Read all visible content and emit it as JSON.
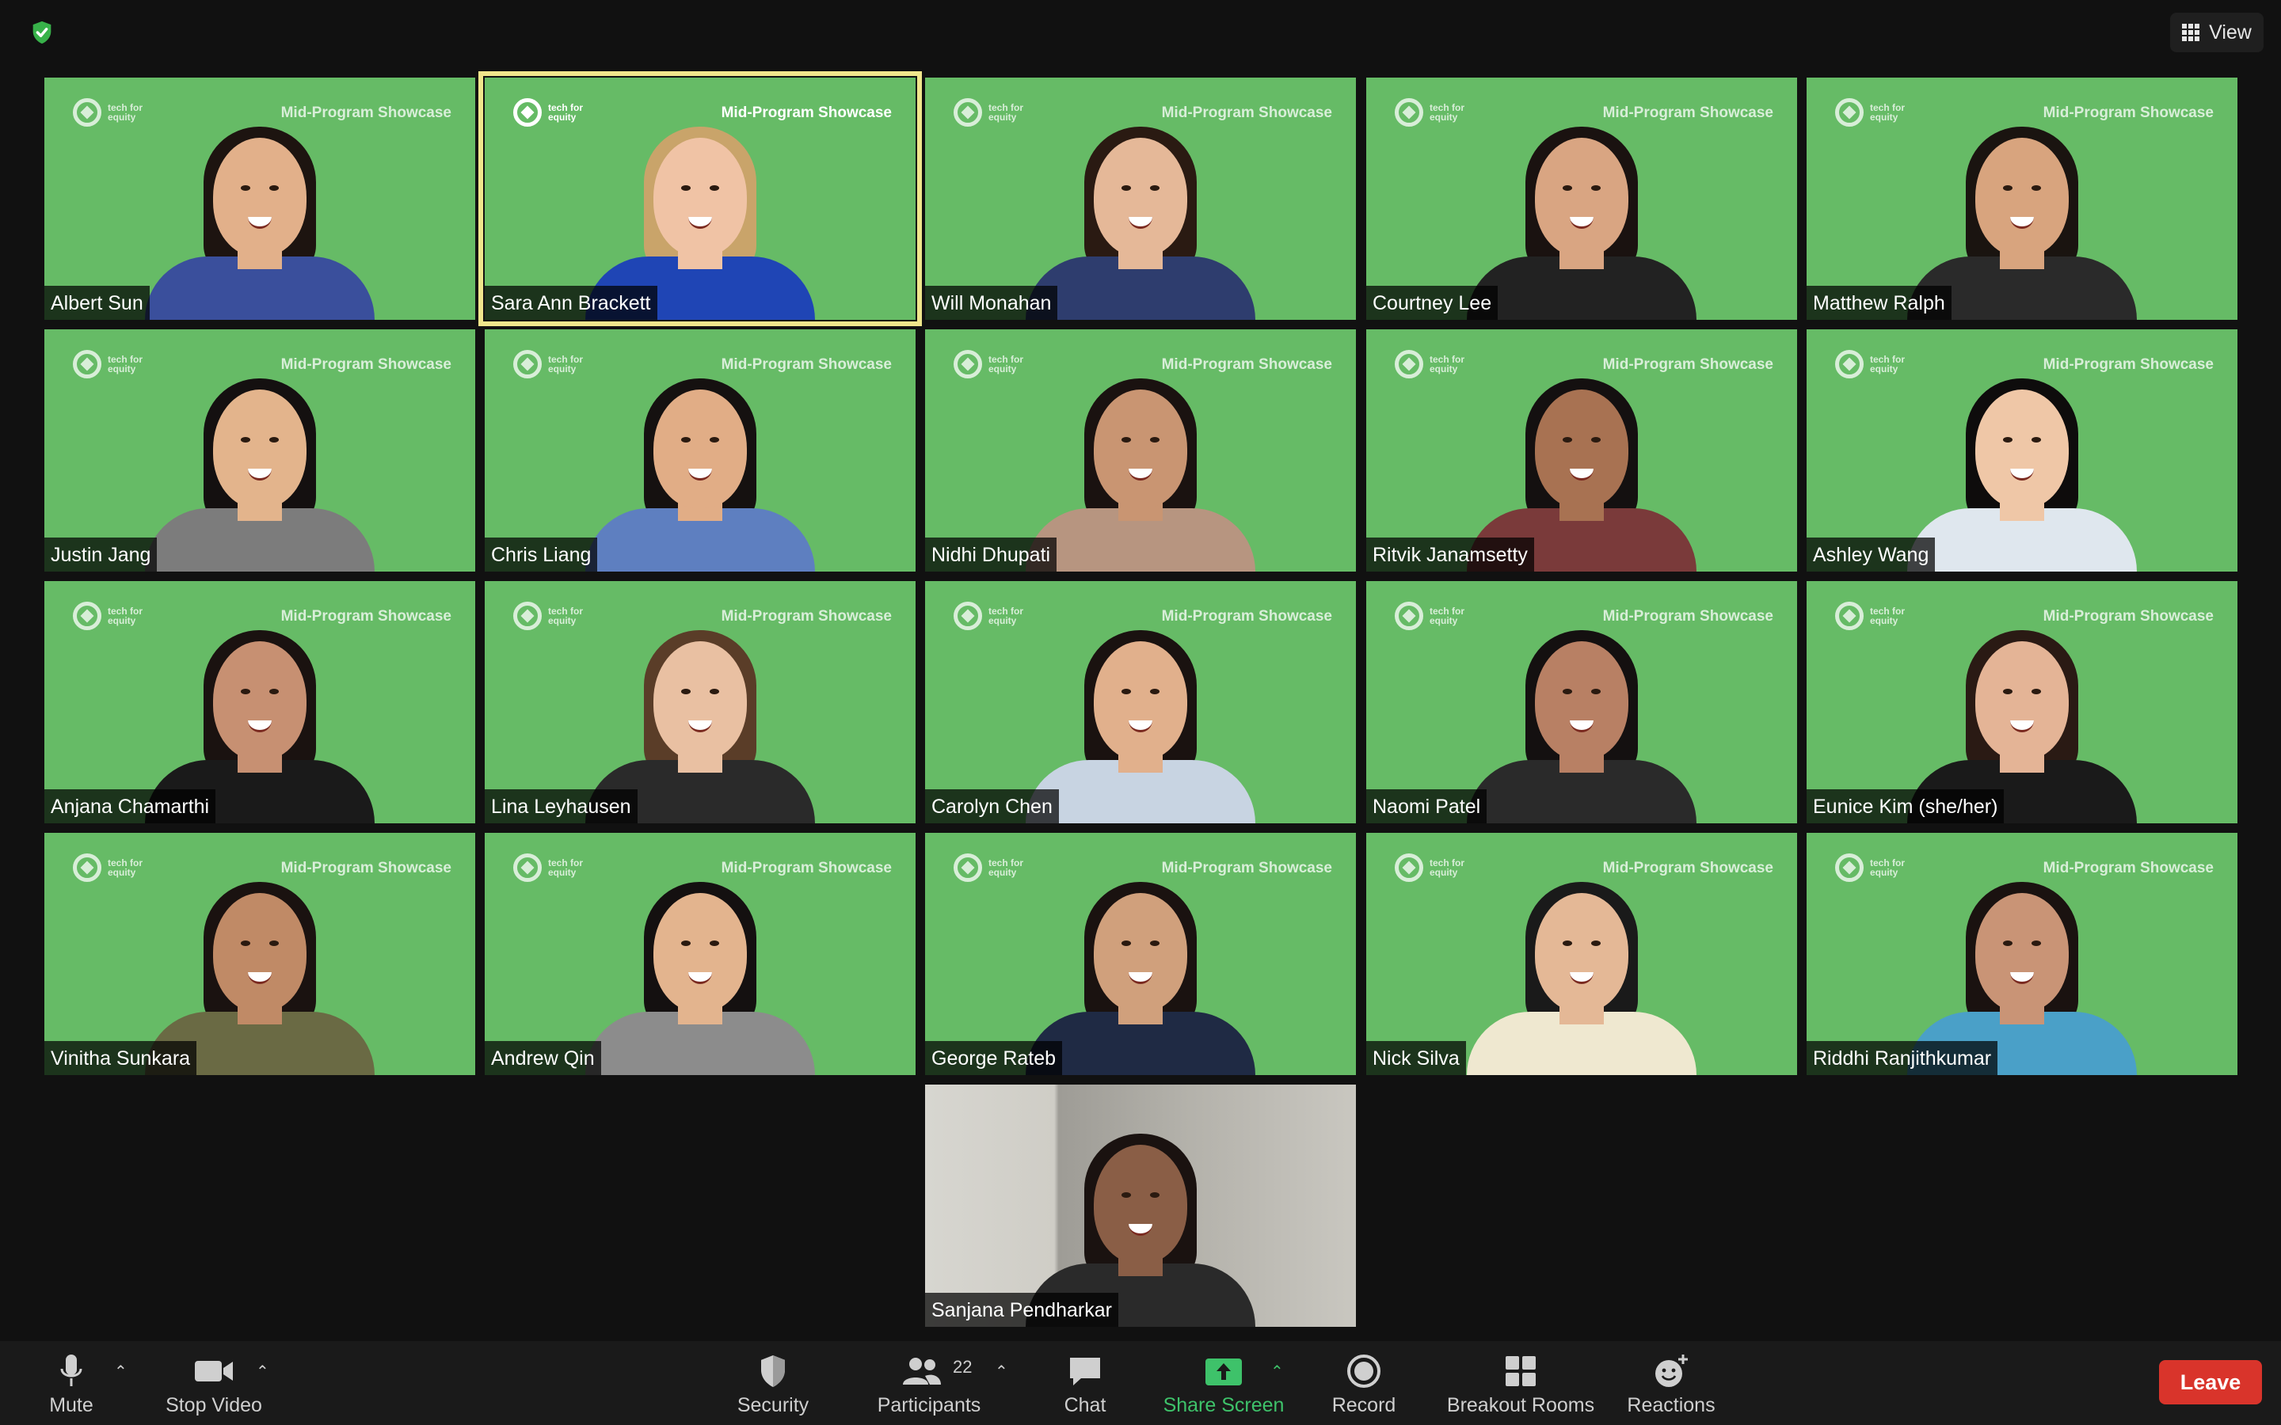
{
  "window": {
    "view_label": "View"
  },
  "meeting": {
    "brand_text": "tech for equity",
    "showcase_label": "Mid-Program Showcase"
  },
  "participants": [
    {
      "name": "Albert Sun",
      "skin": "#e2b08a",
      "hair": "#1d1410",
      "shirt": "#3a4f9c"
    },
    {
      "name": "Sara Ann Brackett",
      "skin": "#f0c3a5",
      "hair": "#c9a46a",
      "shirt": "#1f45b5"
    },
    {
      "name": "Will Monahan",
      "skin": "#e5b898",
      "hair": "#2a1a12",
      "shirt": "#2e3d6e"
    },
    {
      "name": "Courtney Lee",
      "skin": "#d9a582",
      "hair": "#1a1210",
      "shirt": "#222222"
    },
    {
      "name": "Matthew Ralph",
      "skin": "#d8a47e",
      "hair": "#1a1410",
      "shirt": "#2a2a2a"
    },
    {
      "name": "Justin Jang",
      "skin": "#e3b48c",
      "hair": "#141010",
      "shirt": "#7c7c7c"
    },
    {
      "name": "Chris Liang",
      "skin": "#e1ad86",
      "hair": "#151110",
      "shirt": "#5e7fc0"
    },
    {
      "name": "Nidhi Dhupati",
      "skin": "#c99572",
      "hair": "#1a1210",
      "shirt": "#b79580"
    },
    {
      "name": "Ritvik Janamsetty",
      "skin": "#a87252",
      "hair": "#141010",
      "shirt": "#7a3a3a"
    },
    {
      "name": "Ashley Wang",
      "skin": "#efc7a7",
      "hair": "#0e0c0c",
      "shirt": "#dfe7ee"
    },
    {
      "name": "Anjana Chamarthi",
      "skin": "#c79072",
      "hair": "#1a1210",
      "shirt": "#1a1a1a"
    },
    {
      "name": "Lina Leyhausen",
      "skin": "#e9c0a2",
      "hair": "#5a3d28",
      "shirt": "#2a2a2a"
    },
    {
      "name": "Carolyn Chen",
      "skin": "#e1b08c",
      "hair": "#1a1210",
      "shirt": "#c8d4e2"
    },
    {
      "name": "Naomi Patel",
      "skin": "#b88064",
      "hair": "#141010",
      "shirt": "#2a2a2a"
    },
    {
      "name": "Eunice Kim (she/her)",
      "skin": "#e4b496",
      "hair": "#2a1a14",
      "shirt": "#1a1a1a"
    },
    {
      "name": "Vinitha Sunkara",
      "skin": "#c08a66",
      "hair": "#1a1210",
      "shirt": "#6a6a44"
    },
    {
      "name": "Andrew Qin",
      "skin": "#e3b48e",
      "hair": "#141010",
      "shirt": "#8c8c8c"
    },
    {
      "name": "George Rateb",
      "skin": "#d0a07c",
      "hair": "#1a1210",
      "shirt": "#1f2a44"
    },
    {
      "name": "Nick Silva",
      "skin": "#e4b896",
      "hair": "#1a1a1a",
      "shirt": "#efe8d0"
    },
    {
      "name": "Riddhi Ranjithkumar",
      "skin": "#c99476",
      "hair": "#1a1210",
      "shirt": "#4aa0c8"
    },
    {
      "name": "Sanjana Pendharkar",
      "skin": "#8a5e46",
      "hair": "#1a1210",
      "shirt": "#2a2a2a"
    }
  ],
  "toolbar": {
    "mute_label": "Mute",
    "stop_video_label": "Stop Video",
    "security_label": "Security",
    "participants_label": "Participants",
    "participants_count": "22",
    "chat_label": "Chat",
    "share_screen_label": "Share Screen",
    "record_label": "Record",
    "breakout_rooms_label": "Breakout Rooms",
    "reactions_label": "Reactions",
    "leave_label": "Leave",
    "share_color": "#3ec26a",
    "leave_color": "#d9342b"
  }
}
